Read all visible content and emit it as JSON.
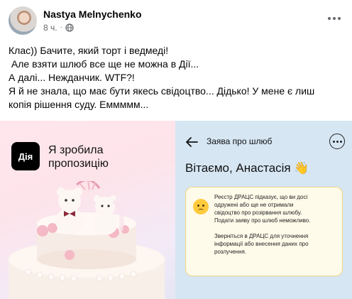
{
  "post": {
    "author": "Nastya Melnychenko",
    "time": "8 ч.",
    "separator": "·",
    "audience_icon": "globe-icon",
    "more_icon": "more-options-icon",
    "text_lines": [
      "Клас)) Бачите, який торт і ведмеді!",
      " Але взяти шлюб все ще не можна в Дії...",
      "А далі... Нежданчик. WTF?!",
      "Я й не знала, що має бути якесь свідоцтво... Дідько! У мене є лиш",
      "копія рішення суду. Еммммм..."
    ]
  },
  "promo": {
    "logo_text": "Дія",
    "line1": "Я зробила",
    "line2": "пропозицію"
  },
  "app_screen": {
    "title": "Заява про шлюб",
    "greeting": "Вітаємо, Анастасія 👋",
    "message_lines_1": [
      "Реєстр ДРАЦС підказує, що ви досі",
      "одружені або ще не отримали",
      "свідоцтво про розірвання шлюбу.",
      "Подати заяву про шлюб неможливо."
    ],
    "message_lines_2": [
      "Зверніться в ДРАЦС для уточнення",
      "інформації або внесення даних про",
      "розлучення."
    ],
    "card_icon": "sad-face-icon"
  },
  "colors": {
    "text": "#050505",
    "meta": "#65676b",
    "card_bg": "#fffbea",
    "card_border": "#f1d585",
    "right_panel_bg": "#d6e6f3"
  }
}
